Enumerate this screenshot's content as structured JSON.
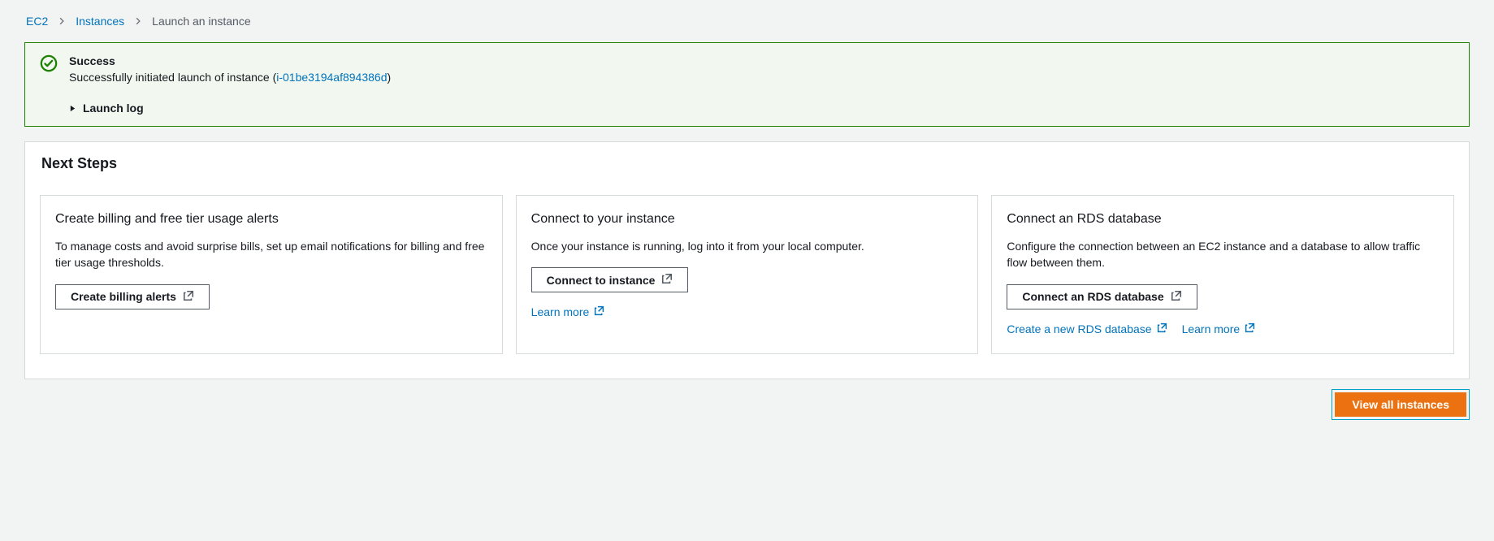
{
  "breadcrumb": {
    "root": "EC2",
    "instances": "Instances",
    "current": "Launch an instance"
  },
  "alert": {
    "title": "Success",
    "message_prefix": "Successfully initiated launch of instance (",
    "instance_id": "i-01be3194af894386d",
    "message_suffix": ")",
    "launch_log": "Launch log"
  },
  "next_steps": {
    "heading": "Next Steps",
    "cards": [
      {
        "title": "Create billing and free tier usage alerts",
        "body": "To manage costs and avoid surprise bills, set up email notifications for billing and free tier usage thresholds.",
        "button": "Create billing alerts"
      },
      {
        "title": "Connect to your instance",
        "body": "Once your instance is running, log into it from your local computer.",
        "button": "Connect to instance",
        "link1": "Learn more"
      },
      {
        "title": "Connect an RDS database",
        "body": "Configure the connection between an EC2 instance and a database to allow traffic flow between them.",
        "button": "Connect an RDS database",
        "link1": "Create a new RDS database",
        "link2": "Learn more"
      }
    ]
  },
  "footer": {
    "view_all": "View all instances"
  }
}
